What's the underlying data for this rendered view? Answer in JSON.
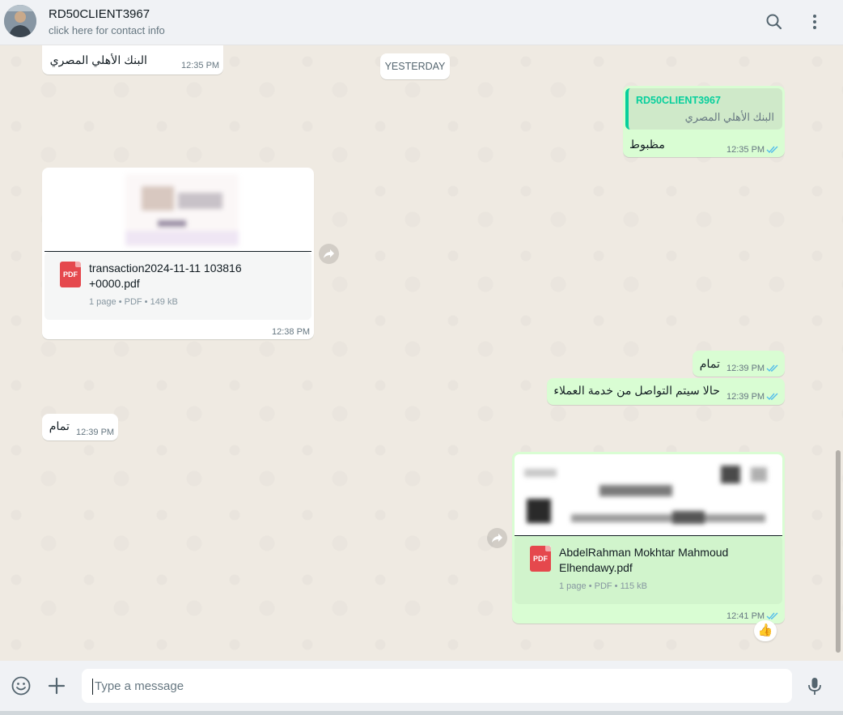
{
  "header": {
    "contact_name": "RD50CLIENT3967",
    "contact_sub": "click here for contact info",
    "icons": [
      "avatar",
      "search-icon",
      "menu-dots-icon"
    ]
  },
  "chat": {
    "date_divider": "YESTERDAY",
    "messages": [
      {
        "id": "m1",
        "direction": "incoming",
        "text": "البنك الأهلي المصري",
        "time": "12:35 PM"
      },
      {
        "id": "m2",
        "direction": "outgoing",
        "quoted_name": "RD50CLIENT3967",
        "quoted_text": "البنك الأهلي المصري",
        "text": "مظبوط",
        "time": "12:35 PM",
        "status": "read"
      },
      {
        "id": "m3",
        "direction": "incoming",
        "type": "document",
        "file_name_line1": "transaction2024-11-11 103816",
        "file_name_line2": "+0000.pdf",
        "file_meta": "1 page • PDF • 149 kB",
        "file_type_label": "PDF",
        "time": "12:38 PM"
      },
      {
        "id": "m4",
        "direction": "outgoing",
        "text": "تمام",
        "time": "12:39 PM",
        "status": "read"
      },
      {
        "id": "m5",
        "direction": "outgoing",
        "text": "حالا سيتم التواصل من خدمة العملاء",
        "time": "12:39 PM",
        "status": "read"
      },
      {
        "id": "m6",
        "direction": "incoming",
        "text": "تمام",
        "time": "12:39 PM"
      },
      {
        "id": "m7",
        "direction": "outgoing",
        "type": "document",
        "file_name_line1": "AbdelRahman Mokhtar Mahmoud",
        "file_name_line2": "Elhendawy.pdf",
        "file_meta": "1 page • PDF • 115 kB",
        "file_type_label": "PDF",
        "time": "12:41 PM",
        "status": "read",
        "reaction": "👍"
      }
    ]
  },
  "composer": {
    "placeholder": "Type a message",
    "icons": [
      "emoji-icon",
      "plus-icon",
      "microphone-icon"
    ]
  },
  "colors": {
    "incoming_bubble": "#ffffff",
    "outgoing_bubble": "#d9fdd3",
    "accent": "#06cf9c",
    "read_ticks": "#53bdeb",
    "chat_background": "#efeae2"
  }
}
